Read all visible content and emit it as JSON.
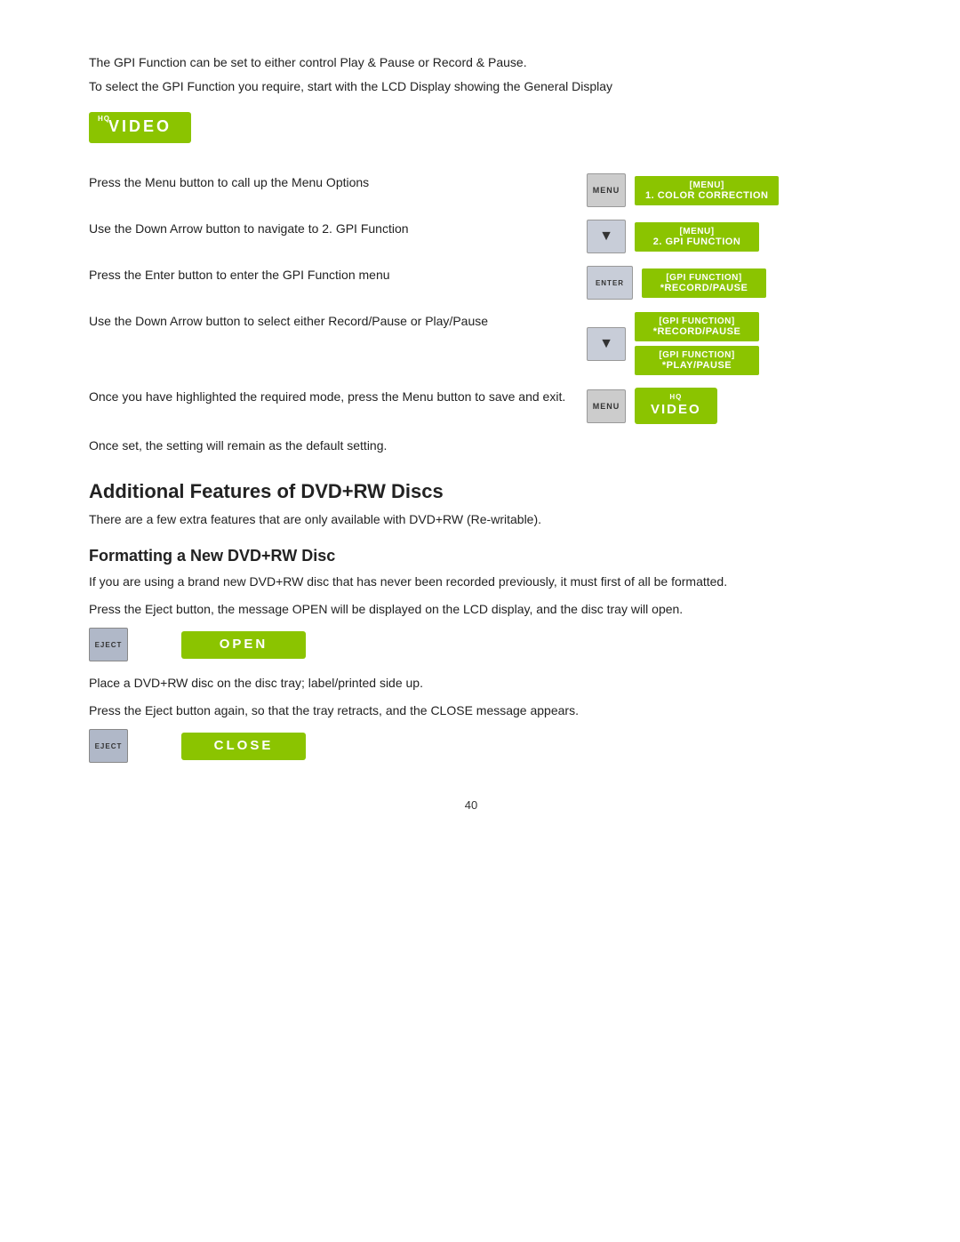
{
  "page": {
    "intro": {
      "line1": "The GPI Function can be set to either control Play & Pause or Record & Pause.",
      "line2": "To select the GPI Function you require, start with the LCD Display showing the General Display"
    },
    "video_badge": "VIDEO",
    "hq_label": "HQ",
    "instructions": [
      {
        "id": "menu",
        "text": "Press the Menu button to call up the Menu Options",
        "button": "MENU",
        "lcd_line1": "[MENU]",
        "lcd_line2": "1. COLOR CORRECTION"
      },
      {
        "id": "down-arrow-gpi",
        "text": "Use the Down Arrow button to navigate to 2. GPI Function",
        "button": "▼",
        "lcd_line1": "[MENU]",
        "lcd_line2": "2. GPI FUNCTION"
      },
      {
        "id": "enter-gpi",
        "text": "Press the Enter button to enter the GPI Function menu",
        "button": "ENTER",
        "lcd_line1": "[GPI FUNCTION]",
        "lcd_line2": "*RECORD/PAUSE"
      }
    ],
    "down_arrow_select": {
      "text": "Use the Down Arrow button to select either Record/Pause or Play/Pause",
      "button": "▼",
      "lcd_options": [
        {
          "line1": "[GPI FUNCTION]",
          "line2": "*RECORD/PAUSE"
        },
        {
          "line1": "[GPI FUNCTION]",
          "line2": "*PLAY/PAUSE"
        }
      ]
    },
    "menu_save": {
      "text": "Once you have highlighted the required mode, press the Menu button to save and exit.",
      "button": "MENU",
      "lcd_line1": "HQ",
      "lcd_line2": "VIDEO"
    },
    "once_set": "Once set, the setting will remain as the default setting.",
    "additional_section": {
      "heading": "Additional Features of DVD+RW Discs",
      "text": "There are a few extra features that are only available with DVD+RW (Re-writable)."
    },
    "formatting_section": {
      "heading": "Formatting a New DVD+RW Disc",
      "para1": "If you are using a brand new DVD+RW disc that has never been recorded previously, it must first of all be formatted.",
      "para2": "Press the Eject button, the message OPEN will be displayed on the LCD display, and the disc tray will open.",
      "eject_button": "EJECT",
      "open_label": "OPEN",
      "para3": "Place a DVD+RW disc on the disc tray; label/printed side up.",
      "para4": "Press the Eject button again, so that the tray retracts, and the CLOSE message appears.",
      "close_label": "CLOSE"
    },
    "page_number": "40"
  }
}
